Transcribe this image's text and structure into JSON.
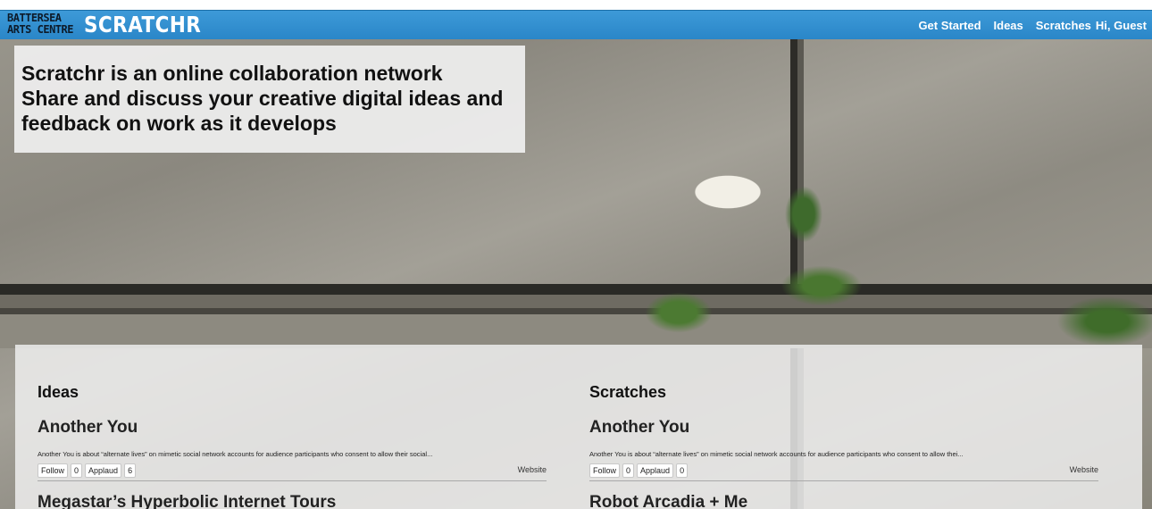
{
  "header": {
    "logo_line1": "BATTERSEA",
    "logo_line2": "ARTS CENTRE",
    "brand": "SCRATCHR",
    "nav": {
      "get_started": "Get Started",
      "ideas": "Ideas",
      "scratches": "Scratches",
      "greeting": "Hi, Guest"
    },
    "color": "#2a86c8"
  },
  "hero": {
    "line1": "Scratchr is an online collaboration network",
    "line2": "Share and discuss your creative digital ideas and",
    "line3": "feedback on work as it develops"
  },
  "ideas": {
    "heading": "Ideas",
    "item_title": "Another You",
    "item_desc": "Another You is about “alternate lives” on mimetic social network accounts for audience participants who consent to allow their social...",
    "follow_label": "Follow",
    "follow_count": "0",
    "applaud_label": "Applaud",
    "applaud_count": "6",
    "website_label": "Website",
    "next_title": "Megastar’s Hyperbolic Internet Tours"
  },
  "scratches": {
    "heading": "Scratches",
    "item_title": "Another You",
    "item_desc": "Another You is about “alternate lives” on mimetic social network accounts for audience participants who consent to allow thei...",
    "follow_label": "Follow",
    "follow_count": "0",
    "applaud_label": "Applaud",
    "applaud_count": "0",
    "website_label": "Website",
    "next_title": "Robot Arcadia + Me"
  }
}
